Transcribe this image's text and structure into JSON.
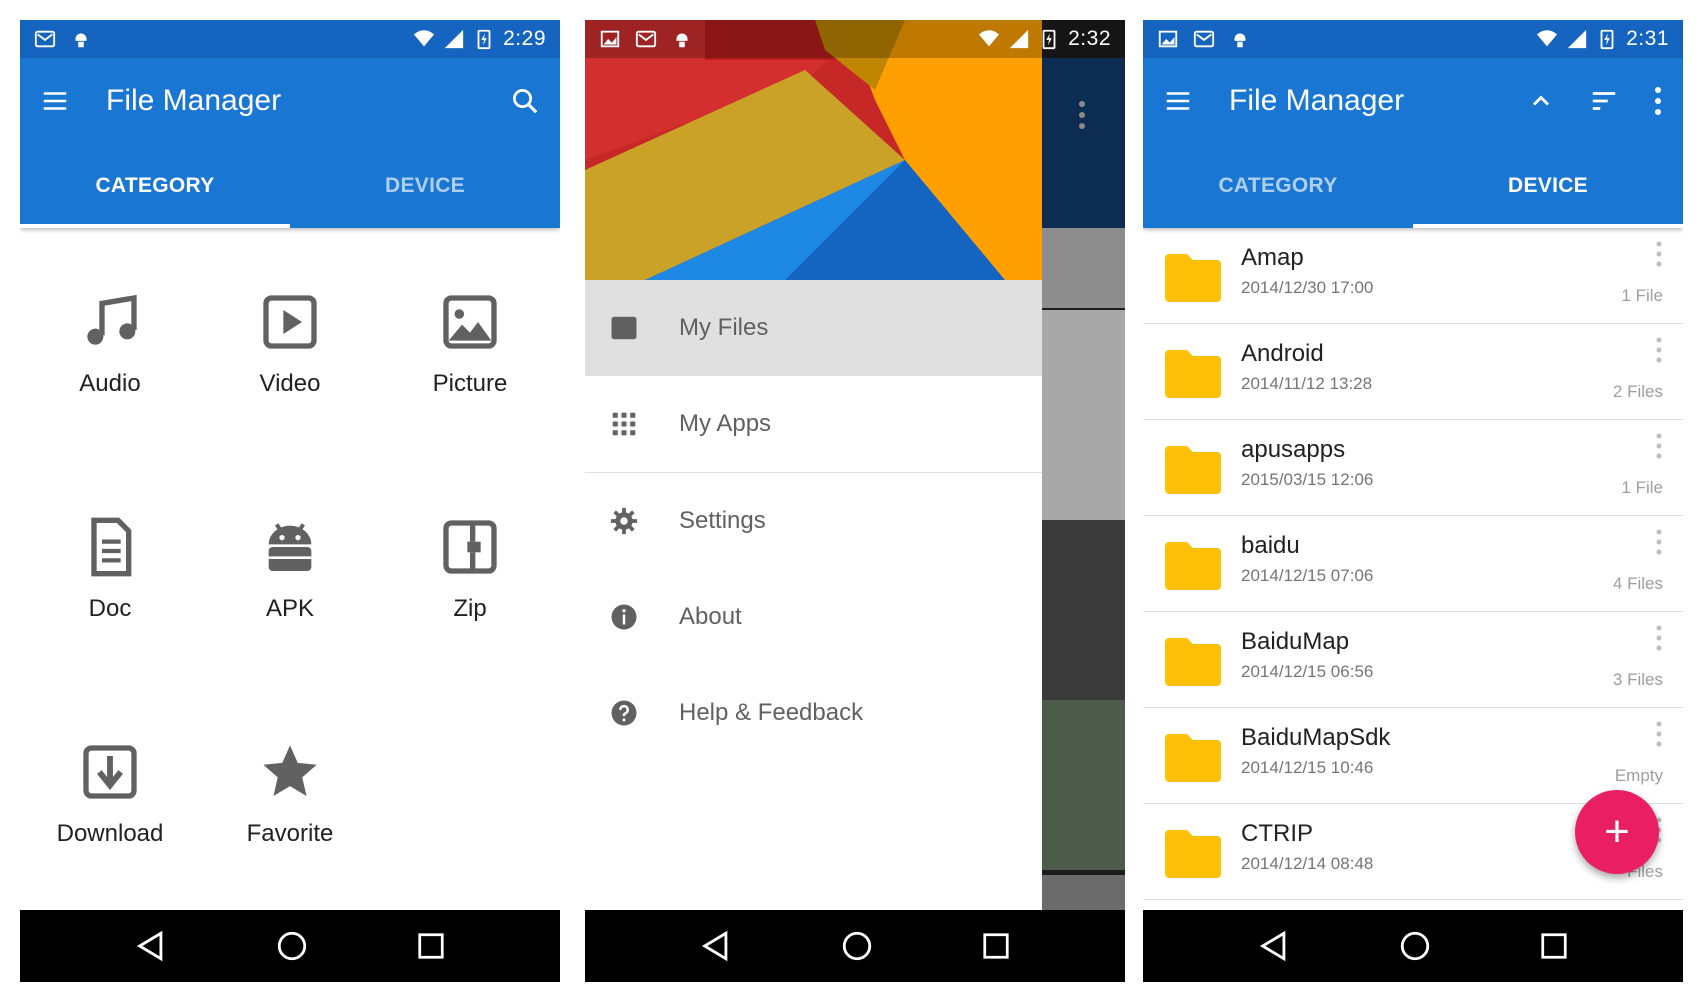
{
  "colors": {
    "primary": "#1976d2",
    "primary_dark": "#1565c0",
    "accent": "#e91e63",
    "folder": "#ffc107",
    "icon_gray": "#616161"
  },
  "screen1": {
    "status_time": "2:29",
    "app_title": "File Manager",
    "tabs": [
      {
        "label": "CATEGORY",
        "active": true
      },
      {
        "label": "DEVICE",
        "active": false
      }
    ],
    "categories": [
      {
        "label": "Audio",
        "icon": "music-note-icon"
      },
      {
        "label": "Video",
        "icon": "video-play-icon"
      },
      {
        "label": "Picture",
        "icon": "picture-icon"
      },
      {
        "label": "Doc",
        "icon": "document-icon"
      },
      {
        "label": "APK",
        "icon": "android-icon"
      },
      {
        "label": "Zip",
        "icon": "zip-icon"
      },
      {
        "label": "Download",
        "icon": "download-icon"
      },
      {
        "label": "Favorite",
        "icon": "star-icon"
      }
    ]
  },
  "screen2": {
    "status_time": "2:32",
    "drawer_items": [
      {
        "label": "My Files",
        "icon": "folder-icon",
        "active": true
      },
      {
        "label": "My Apps",
        "icon": "apps-grid-icon",
        "active": false
      },
      {
        "label": "Settings",
        "icon": "gear-icon",
        "active": false
      },
      {
        "label": "About",
        "icon": "info-icon",
        "active": false
      },
      {
        "label": "Help & Feedback",
        "icon": "help-icon",
        "active": false
      }
    ]
  },
  "screen3": {
    "status_time": "2:31",
    "app_title": "File Manager",
    "tabs": [
      {
        "label": "CATEGORY",
        "active": false
      },
      {
        "label": "DEVICE",
        "active": true
      }
    ],
    "files": [
      {
        "name": "Amap",
        "date": "2014/12/30 17:00",
        "count": "1 File"
      },
      {
        "name": "Android",
        "date": "2014/11/12 13:28",
        "count": "2 Files"
      },
      {
        "name": "apusapps",
        "date": "2015/03/15 12:06",
        "count": "1 File"
      },
      {
        "name": "baidu",
        "date": "2014/12/15 07:06",
        "count": "4 Files"
      },
      {
        "name": "BaiduMap",
        "date": "2014/12/15 06:56",
        "count": "3 Files"
      },
      {
        "name": "BaiduMapSdk",
        "date": "2014/12/15 10:46",
        "count": "Empty"
      },
      {
        "name": "CTRIP",
        "date": "2014/12/14 08:48",
        "count": "Files"
      }
    ],
    "fab_label": "+"
  }
}
